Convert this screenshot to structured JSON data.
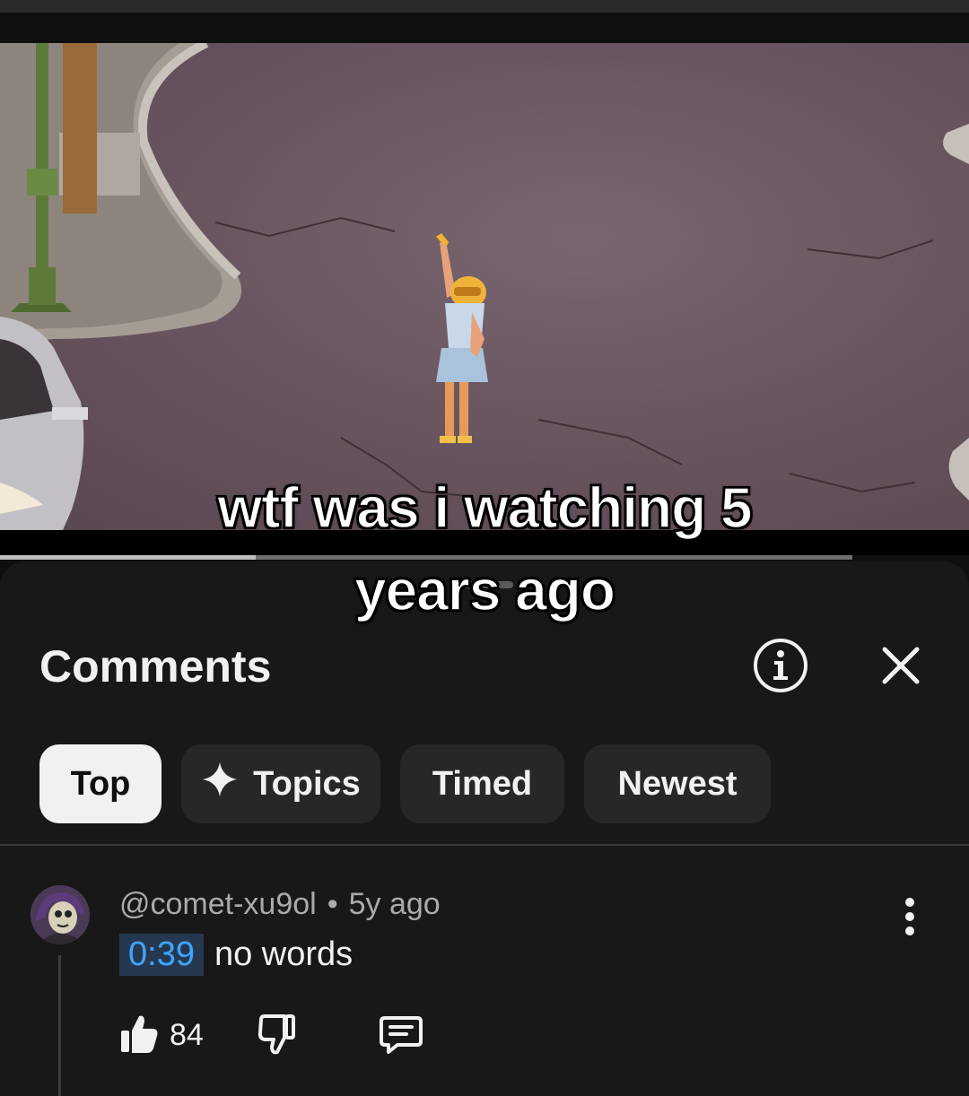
{
  "video": {
    "caption_line1": "wtf was i watching 5",
    "caption_line2": "years ago",
    "progress_fraction": 0.3
  },
  "comments_panel": {
    "title": "Comments",
    "info_icon": "info-icon",
    "close_icon": "close-icon",
    "chips": [
      {
        "label": "Top",
        "active": true
      },
      {
        "label": "Topics",
        "icon": "sparkle-icon",
        "active": false
      },
      {
        "label": "Timed",
        "active": false
      },
      {
        "label": "Newest",
        "active": false
      }
    ],
    "comment": {
      "author": "@comet-xu9ol",
      "separator": "•",
      "age": "5y ago",
      "timestamp": "0:39",
      "text": "no words",
      "likes": "84"
    }
  },
  "colors": {
    "background": "#0f0f0f",
    "sheet": "#181818",
    "chip": "#272727",
    "chip_active": "#f1f1f1",
    "link_blue": "#3ea6ff"
  }
}
